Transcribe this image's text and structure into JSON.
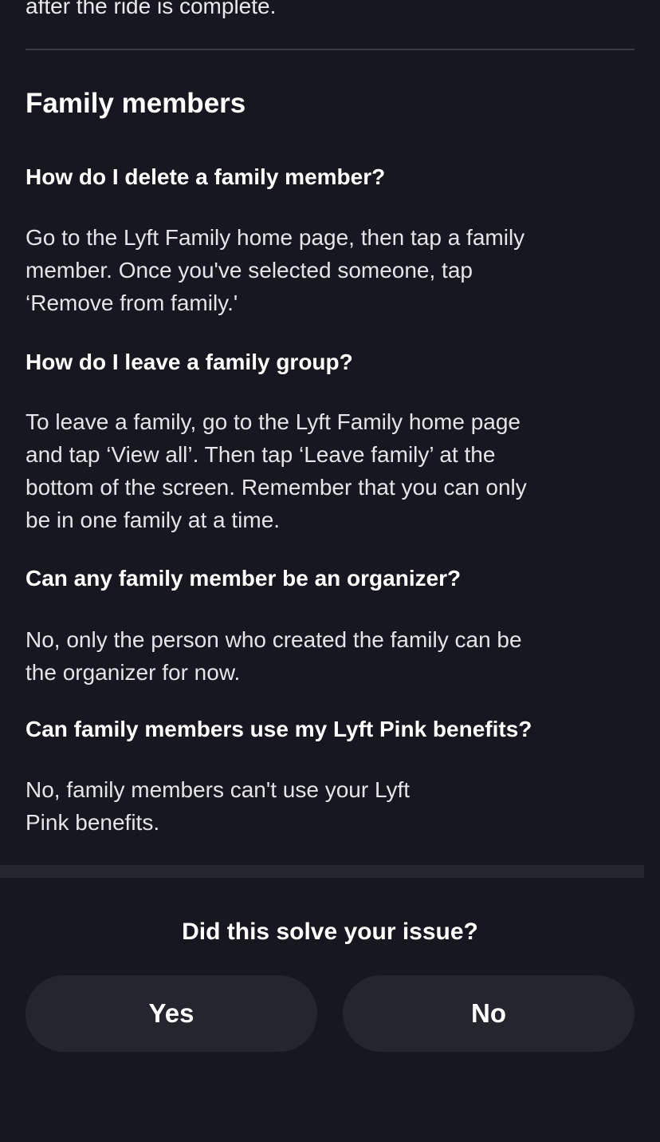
{
  "previous_section": {
    "trailing_text": "after the ride is complete."
  },
  "family_members": {
    "title": "Family members",
    "faqs": [
      {
        "question": "How do I delete a family member?",
        "answer_lines": [
          "Go to the Lyft Family home page, then tap a family",
          "member. Once you've selected someone, tap",
          "‘Remove from family.'"
        ]
      },
      {
        "question": "How do I leave a family group?",
        "answer_lines": [
          "To leave a family, go to the Lyft Family home page",
          "and tap ‘View all’. Then tap ‘Leave family’ at the",
          "bottom of the screen. Remember that you can only",
          "be in one family at a time."
        ]
      },
      {
        "question": "Can any family member be an organizer?",
        "answer_lines": [
          "No, only the person who created the family can be",
          "the organizer for now."
        ]
      },
      {
        "question": "Can family members use my Lyft Pink benefits?",
        "answer_lines": [
          "No, family members can't use your Lyft",
          "Pink benefits."
        ]
      }
    ]
  },
  "feedback": {
    "prompt": "Did this solve your issue?",
    "yes_label": "Yes",
    "no_label": "No"
  }
}
